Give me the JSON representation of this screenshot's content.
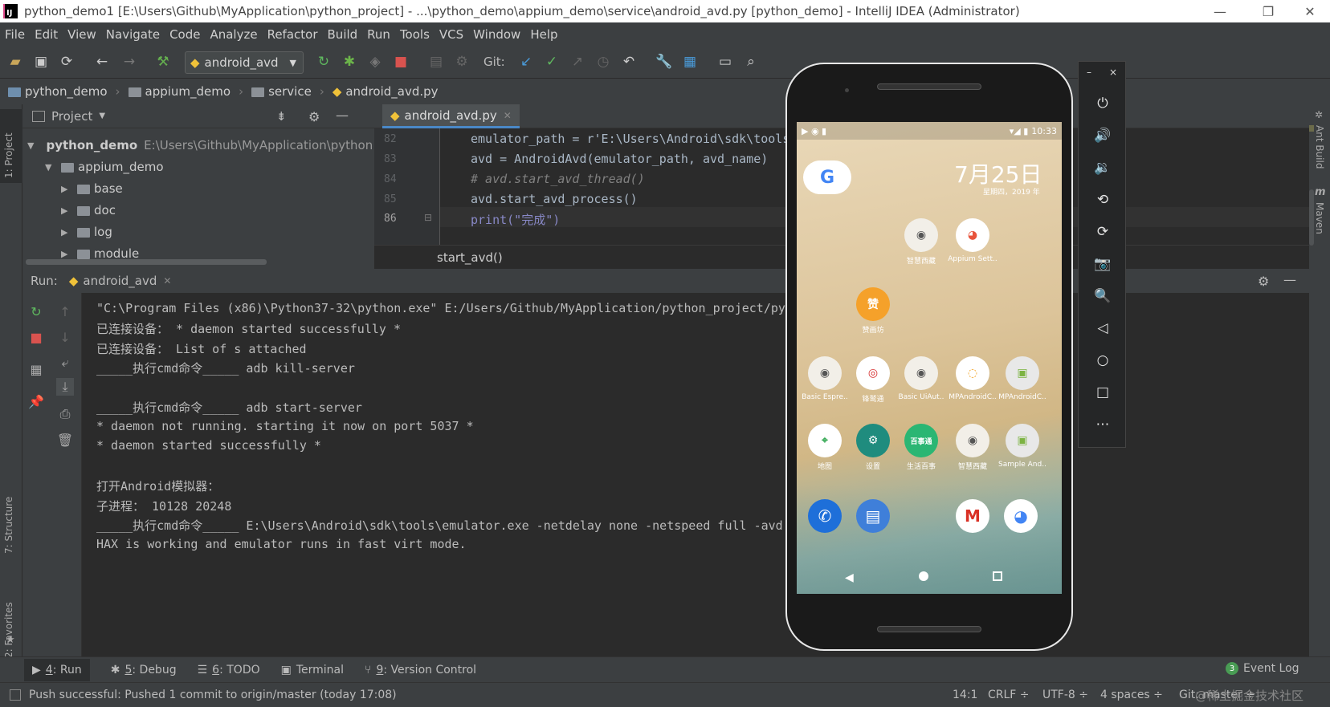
{
  "window": {
    "logo": "IJ",
    "title": "python_demo1 [E:\\Users\\Github\\MyApplication\\python_project] - ...\\python_demo\\appium_demo\\service\\android_avd.py [python_demo] - IntelliJ IDEA (Administrator)",
    "minimize": "—",
    "restore": "❐",
    "close": "✕"
  },
  "menu": [
    "File",
    "Edit",
    "View",
    "Navigate",
    "Code",
    "Analyze",
    "Refactor",
    "Build",
    "Run",
    "Tools",
    "VCS",
    "Window",
    "Help"
  ],
  "toolbar": {
    "run_config": "android_avd",
    "git_label": "Git:"
  },
  "navbar": {
    "crumbs": [
      "python_demo",
      "appium_demo",
      "service",
      "android_avd.py"
    ]
  },
  "left_strip": {
    "project": "1: Project",
    "structure": "7: Structure",
    "favorites": "2: Favorites"
  },
  "right_strip": {
    "ant": "Ant Build",
    "maven": "Maven"
  },
  "project_panel": {
    "title": "Project",
    "root_name": "python_demo",
    "root_path": "E:\\Users\\Github\\MyApplication\\python_p",
    "items": [
      "appium_demo",
      "base",
      "doc",
      "log",
      "module"
    ]
  },
  "editor": {
    "tab": "android_avd.py",
    "lines": [
      {
        "num": "82",
        "code_plain": "emulator_path = r'E:\\Users\\Android\\sdk\\tools\\e"
      },
      {
        "num": "83",
        "code_plain": "avd = AndroidAvd(emulator_path, avd_name)"
      },
      {
        "num": "84",
        "code_plain": "# avd.start_avd_thread()"
      },
      {
        "num": "85",
        "code_plain": "avd.start_avd_process()"
      },
      {
        "num": "86",
        "code_plain": "print(\"完成\")"
      }
    ],
    "function_crumb": "start_avd()"
  },
  "run_panel": {
    "label": "Run:",
    "tab": "android_avd",
    "console": [
      "\"C:\\Program Files (x86)\\Python37-32\\python.exe\" E:/Users/Github/MyApplication/python_project/python_",
      "已连接设备： * daemon started successfully *",
      "已连接设备： List of s attached",
      "_____执行cmd命令_____ adb kill-server",
      "",
      "_____执行cmd命令_____ adb start-server",
      "* daemon not running. starting it now on port 5037 *",
      "* daemon started successfully *",
      "",
      "打开Android模拟器：",
      "子进程： 10128 20248",
      "_____执行cmd命令_____ E:\\Users\\Android\\sdk\\tools\\emulator.exe -netdelay none -netspeed full -avd Ne",
      "HAX is working and emulator runs in fast virt mode."
    ]
  },
  "bottom_tabs": [
    {
      "key": "4",
      "label": ": Run",
      "icon": "play-icon"
    },
    {
      "key": "5",
      "label": ": Debug",
      "icon": "bug-icon"
    },
    {
      "key": "6",
      "label": ": TODO",
      "icon": "list-icon"
    },
    {
      "key": "",
      "label": "Terminal",
      "icon": "terminal-icon"
    },
    {
      "key": "9",
      "label": ": Version Control",
      "icon": "vcs-icon"
    }
  ],
  "event_log": {
    "count": "3",
    "label": "Event Log"
  },
  "status": {
    "message": "Push successful: Pushed 1 commit to origin/master (today 17:08)",
    "position": "14:1",
    "line_sep": "CRLF ÷",
    "encoding": "UTF-8 ÷",
    "indent": "4 spaces ÷",
    "git": "Git: master ÷",
    "watermark": "@稀土掘金技术社区"
  },
  "phone": {
    "time": "10:33",
    "date": "7月25日",
    "weekday": "星期四，2019 年",
    "google": "G",
    "apps": [
      {
        "label": "智慧西藏",
        "glyph": "◉",
        "bg": "#f2efe8",
        "fg": "#555"
      },
      {
        "label": "Appium Sett..",
        "glyph": "◕",
        "bg": "#ffffff",
        "fg": "#e8543c"
      },
      {
        "label": "赞画坊",
        "glyph": "赞",
        "bg": "#f5a12a",
        "fg": "#fff"
      },
      {
        "label": "Basic Espre..",
        "glyph": "◉",
        "bg": "#f2efe8",
        "fg": "#555"
      },
      {
        "label": "锋鹫通",
        "glyph": "◎",
        "bg": "#ffffff",
        "fg": "#d62b2b"
      },
      {
        "label": "Basic UiAut..",
        "glyph": "◉",
        "bg": "#f2efe8",
        "fg": "#555"
      },
      {
        "label": "MPAndroidC..",
        "glyph": "◌",
        "bg": "#ffffff",
        "fg": "#f4a62a"
      },
      {
        "label": "MPAndroidC..",
        "glyph": "▣",
        "bg": "#e8e8e8",
        "fg": "#7cb342"
      },
      {
        "label": "地图",
        "glyph": "⌖",
        "bg": "#ffffff",
        "fg": "#34a853"
      },
      {
        "label": "设置",
        "glyph": "⚙",
        "bg": "#1f8c7e",
        "fg": "#fff"
      },
      {
        "label": "生活百事",
        "glyph": "百事通",
        "bg": "#2bb673",
        "fg": "#fff"
      },
      {
        "label": "智慧西藏",
        "glyph": "◉",
        "bg": "#f2efe8",
        "fg": "#555"
      },
      {
        "label": "Sample And..",
        "glyph": "▣",
        "bg": "#e8e8e8",
        "fg": "#7cb342"
      }
    ],
    "dock": [
      {
        "glyph": "✆",
        "bg": "#1e6fd9",
        "fg": "#fff"
      },
      {
        "glyph": "▤",
        "bg": "#3f7fd9",
        "fg": "#fff"
      },
      {
        "glyph": "M",
        "bg": "#ffffff",
        "fg": "#d93025"
      },
      {
        "glyph": "◕",
        "bg": "#ffffff",
        "fg": "#4285f4"
      }
    ]
  },
  "emulator_tools": [
    "⏻",
    "🔊",
    "🔉",
    "⟲",
    "⟳",
    "📷",
    "🔍",
    "◁",
    "○",
    "□",
    "⋯"
  ]
}
